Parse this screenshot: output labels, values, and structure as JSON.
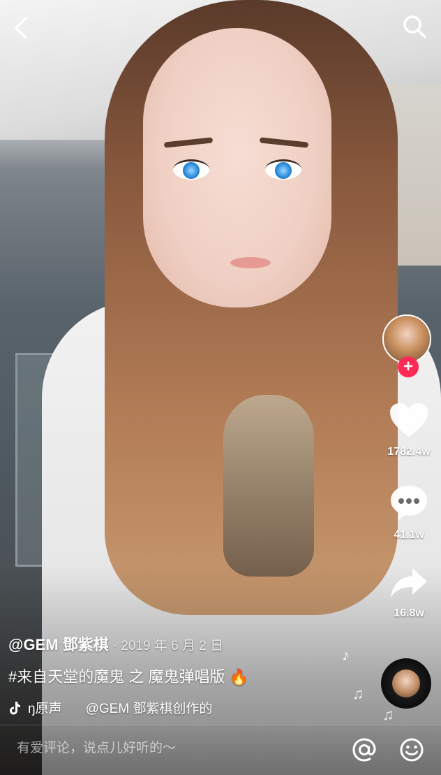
{
  "author": {
    "handle": "@GEM 鄧紫棋",
    "date": "· 2019 年 6 月 2 日"
  },
  "description": "#来自天堂的魔鬼 之 魔鬼弹唱版 🔥",
  "music": {
    "icon": "tiktok-note-icon",
    "text_a": "ŋ原声",
    "text_b": "@GEM 鄧紫棋创作的"
  },
  "actions": {
    "likes": "1782.4w",
    "comments": "41.1w",
    "shares": "16.8w",
    "follow_symbol": "+"
  },
  "comment_bar": {
    "placeholder": "有爱评论，说点儿好听的～"
  },
  "colors": {
    "follow_button": "#fe2c55",
    "text": "#ffffff"
  }
}
